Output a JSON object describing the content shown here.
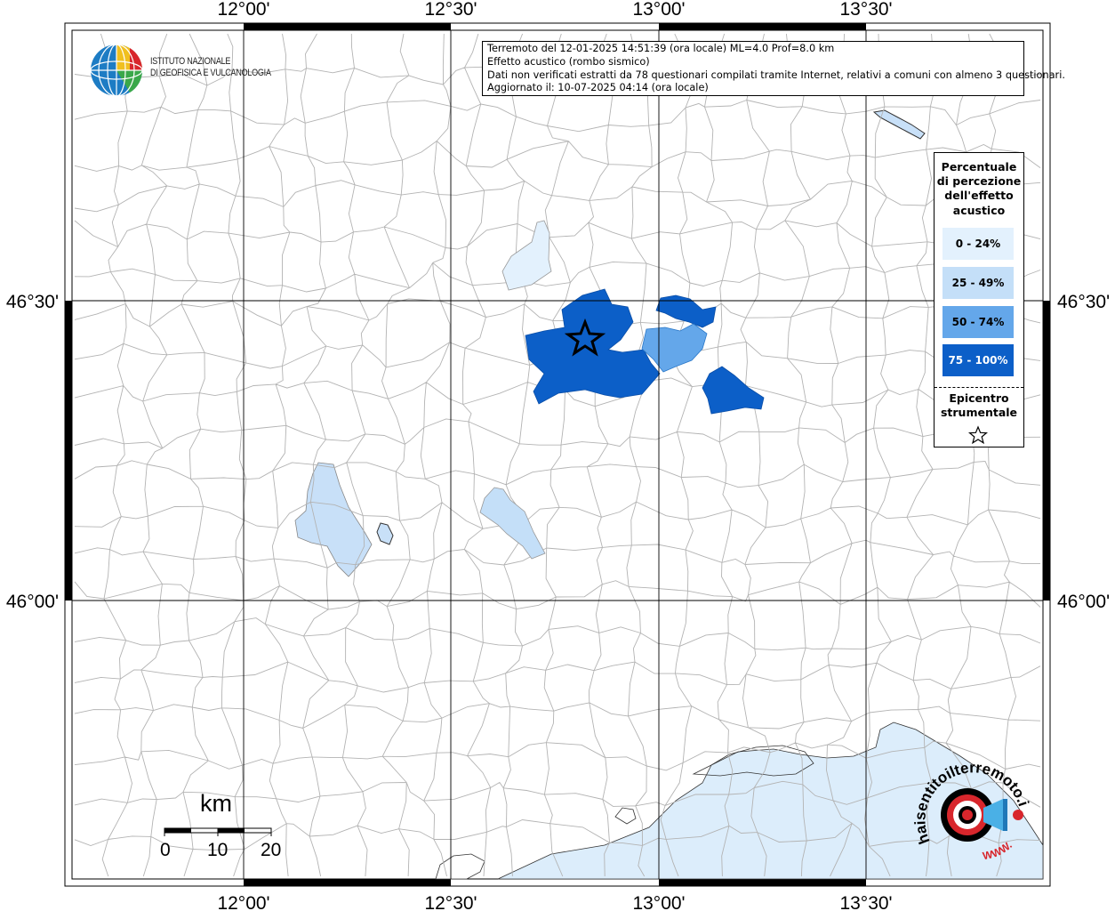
{
  "map": {
    "lon_ticks": [
      "12°00'",
      "12°30'",
      "13°00'",
      "13°30'"
    ],
    "lat_ticks": [
      "46°30'",
      "46°00'"
    ]
  },
  "info": {
    "line1": "Terremoto del 12-01-2025 14:51:39 (ora locale) ML=4.0 Prof=8.0 km",
    "line2": "Effetto acustico (rombo sismico)",
    "line3": "Dati non verificati estratti da 78 questionari compilati tramite Internet, relativi a comuni con almeno 3 questionari.",
    "line4": "Aggiornato il: 10-07-2025 04:14 (ora locale)"
  },
  "legend": {
    "title_lines": [
      "Percentuale",
      "di percezione",
      "dell'effetto",
      "acustico"
    ],
    "items": [
      {
        "label": "0 - 24%",
        "color": "#e3f1fd"
      },
      {
        "label": "25 - 49%",
        "color": "#c4dff8"
      },
      {
        "label": "50 - 74%",
        "color": "#64a7ea"
      },
      {
        "label": "75 - 100%",
        "color": "#0c5fc8"
      }
    ],
    "epicenter_lines": [
      "Epicentro",
      "strumentale"
    ],
    "epicenter_icon": "star-outline-icon"
  },
  "institute": {
    "line1": "ISTITUTO NAZIONALE",
    "line2": "DI GEOFISICA E VULCANOLOGIA"
  },
  "scale": {
    "unit": "km",
    "labels": [
      "0",
      "10",
      "20"
    ]
  },
  "logo": {
    "text": "haisentitoilterremoto.it",
    "url_prefix": "WWW.",
    "icon": "megaphone-target-icon"
  },
  "colors": {
    "sea": "#dcedfb",
    "lake": "#c8e0f8",
    "border": "#b3b3b3"
  }
}
